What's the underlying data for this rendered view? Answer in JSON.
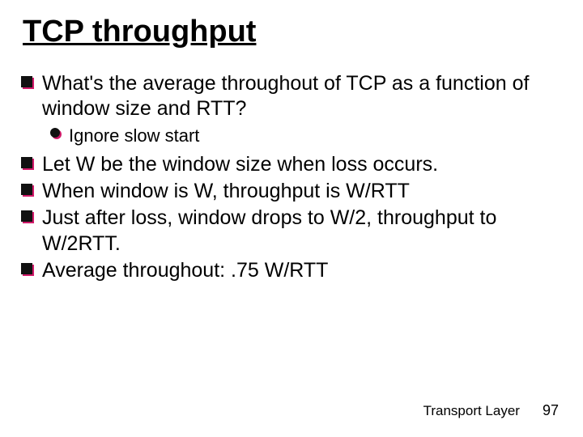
{
  "title": "TCP throughput",
  "bullets": {
    "b1": "What's the average throughout of TCP as a function of window size and RTT?",
    "b1a": "Ignore slow start",
    "b2": "Let W be the window size when loss occurs.",
    "b3": "When window is W, throughput is W/RTT",
    "b4": "Just after loss, window drops to W/2, throughput to W/2RTT.",
    "b5": "Average throughout: .75 W/RTT"
  },
  "footer": {
    "label": "Transport Layer",
    "page": "97"
  }
}
